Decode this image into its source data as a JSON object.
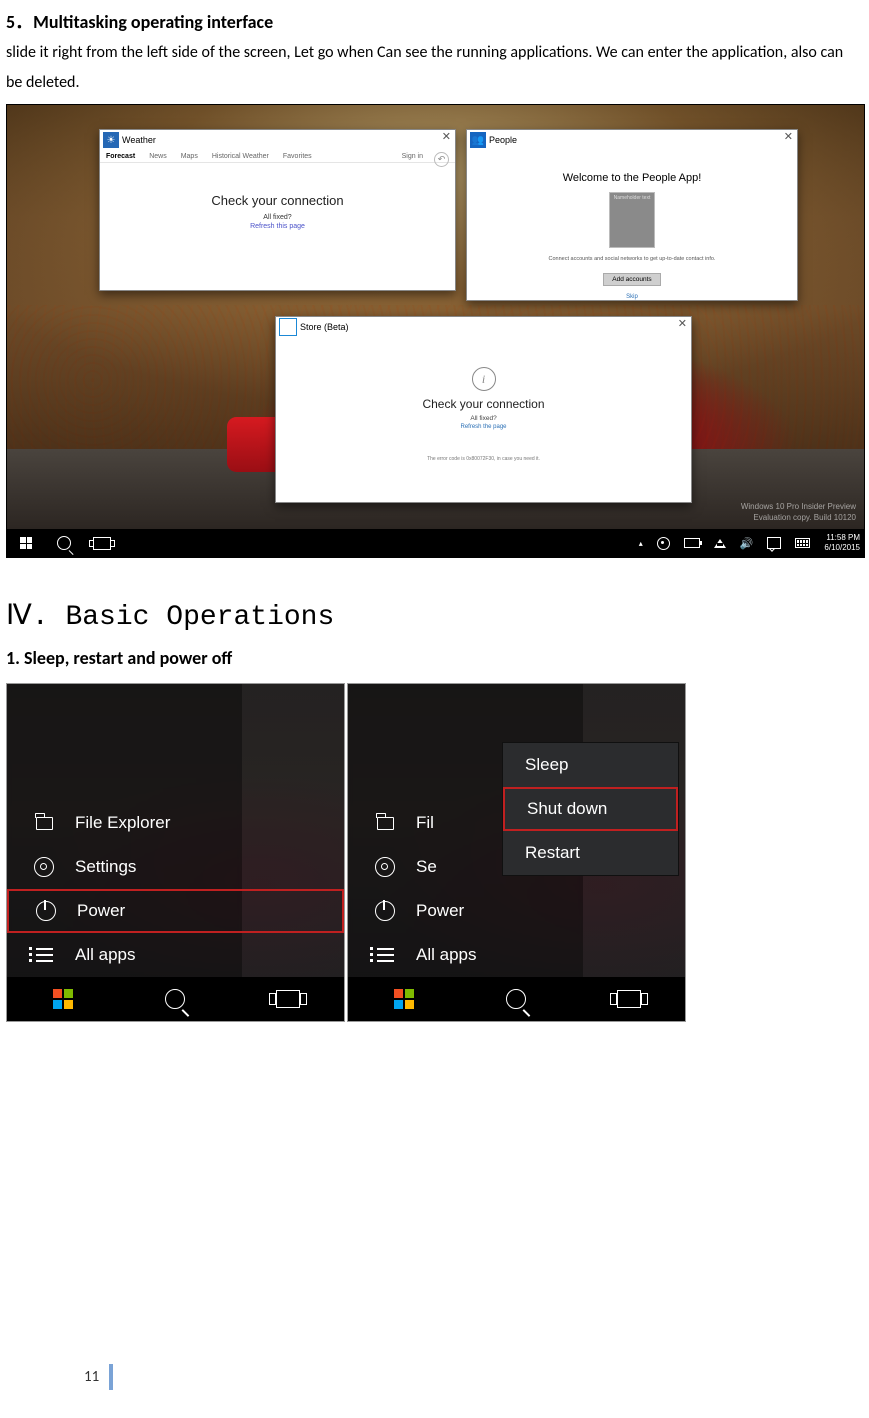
{
  "section5": {
    "heading": "5．Multitasking operating interface",
    "paragraph": "slide it right from the left side of the screen, Let go when Can see the running applications. We can enter the application, also can be deleted."
  },
  "shot1": {
    "watermark_line1": "Windows 10 Pro Insider Preview",
    "watermark_line2": "Evaluation copy. Build 10120",
    "weather": {
      "title": "Weather",
      "tabs": [
        "Forecast",
        "News",
        "Maps",
        "Historical Weather",
        "Favorites"
      ],
      "signin": "Sign in",
      "headline": "Check your connection",
      "sub": "All fixed?",
      "refresh": "Refresh this page"
    },
    "people": {
      "title": "People",
      "welcome": "Welcome to the People App!",
      "placeholder_caption": "Nameholder text",
      "desc": "Connect accounts and social networks to get up-to-date contact info.",
      "button": "Add accounts",
      "skip": "Skip"
    },
    "store": {
      "title": "Store (Beta)",
      "headline": "Check your connection",
      "sub": "All fixed?",
      "refresh": "Refresh the page",
      "error": "The error code is 0x80072F30, in case you need it."
    },
    "taskbar": {
      "time": "11:58 PM",
      "date": "6/10/2015"
    }
  },
  "section4": {
    "heading": "Ⅳ. Basic Operations",
    "sub1": "1.  Sleep, restart and power off"
  },
  "start_items": {
    "file_explorer": "File Explorer",
    "settings": "Settings",
    "power": "Power",
    "all_apps": "All apps"
  },
  "start_items_trunc": {
    "file_explorer": "Fil",
    "settings": "Se"
  },
  "power_menu": {
    "sleep": "Sleep",
    "shutdown": "Shut down",
    "restart": "Restart"
  },
  "page_number": "11"
}
